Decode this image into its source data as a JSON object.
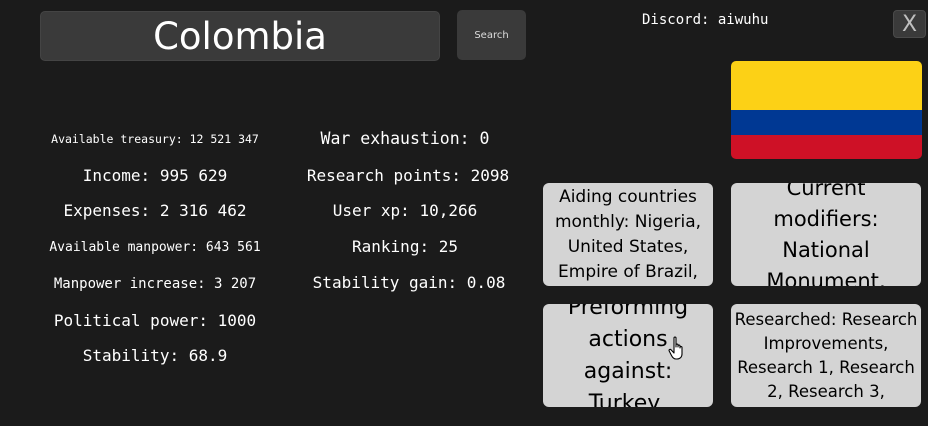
{
  "header": {
    "country_name": "Colombia",
    "search_label": "Search",
    "discord_text": "Discord: aiwuhu",
    "close_label": "X"
  },
  "flag": {
    "country": "Colombia",
    "colors": [
      "#fcd116",
      "#003893",
      "#ce1126"
    ]
  },
  "stats_left": {
    "treasury": "Available treasury: 12 521 347",
    "income": "Income:  995 629",
    "expenses": "Expenses: 2 316 462",
    "manpower": "Available manpower:  643 561",
    "manpower_increase": "Manpower increase: 3 207",
    "political_power": "Political power: 1000",
    "stability": "Stability: 68.9"
  },
  "stats_right": {
    "war_exhaustion": "War exhaustion: 0",
    "research_points": "Research points: 2098",
    "user_xp": "User xp: 10,266",
    "ranking": "Ranking: 25",
    "stability_gain": "Stability gain: 0.08"
  },
  "cards": {
    "aiding": "Aiding countries monthly: Nigeria, United States, Empire of Brazil,",
    "modifiers": "Current modifiers: National Monument,",
    "actions": "Preforming actions against: Turkey,",
    "researched": "Researched: Research Improvements, Research 1, Research 2, Research 3,"
  },
  "icons": {
    "cursor": "hand-pointer-icon"
  },
  "colors": {
    "background": "#1b1b1b",
    "panel": "#3a3a3a",
    "card": "#d4d4d4",
    "text": "#ffffff"
  }
}
